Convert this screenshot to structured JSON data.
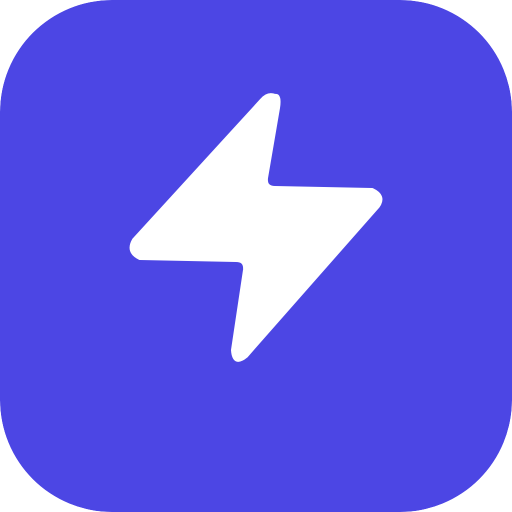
{
  "app_icon": {
    "icon_name": "lightning-bolt-icon",
    "background_color": "#4C46E4",
    "glyph_color": "#FFFFFF"
  }
}
